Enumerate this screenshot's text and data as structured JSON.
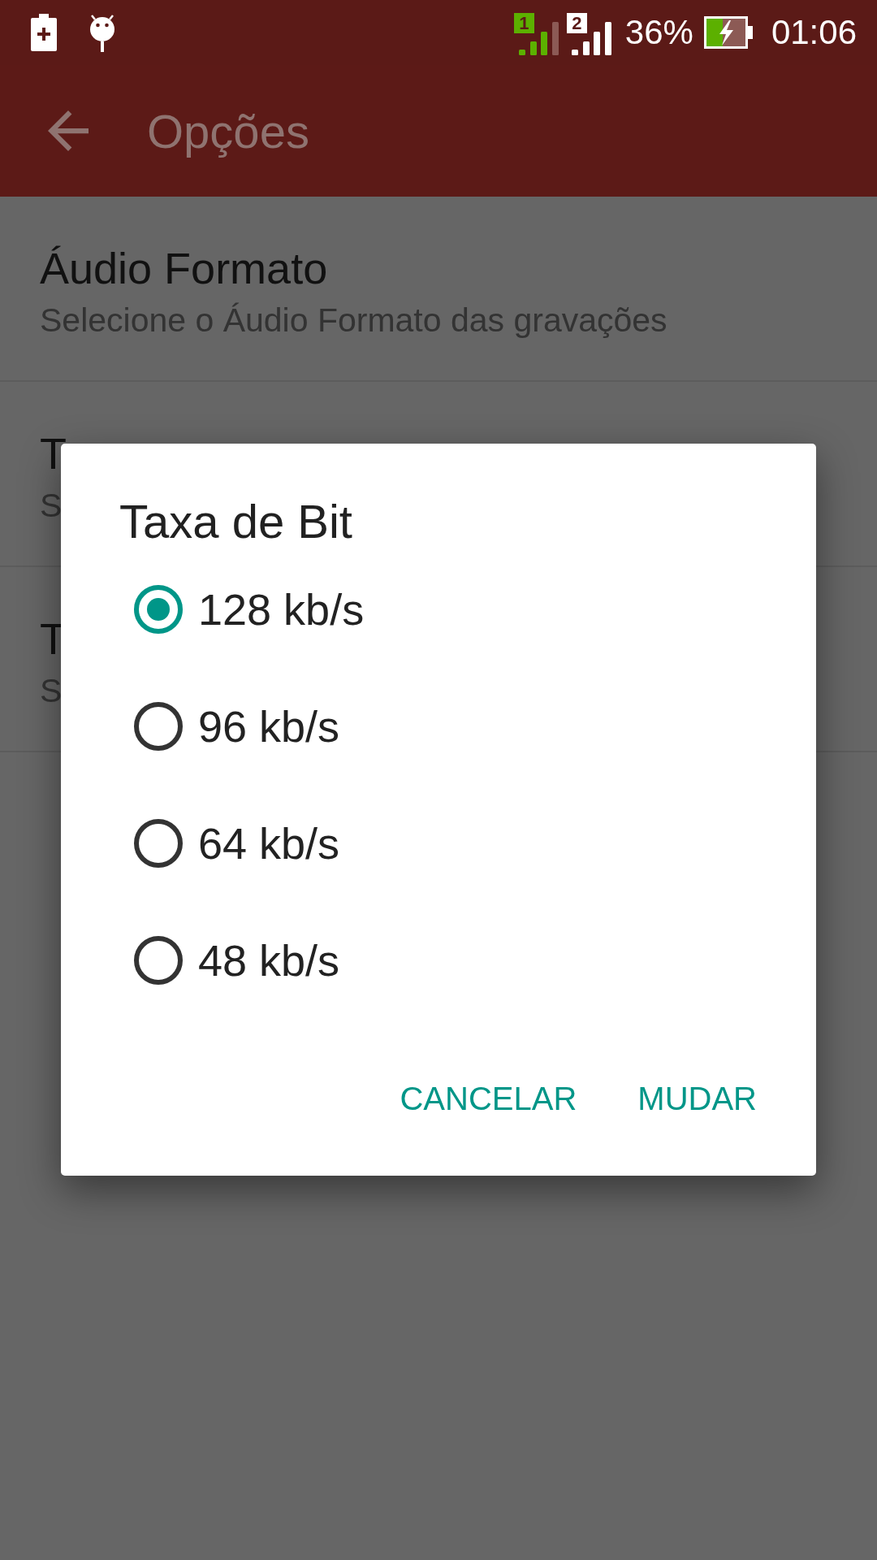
{
  "status_bar": {
    "sims": [
      {
        "label": "1",
        "color": "#5cb000",
        "kind": "partial"
      },
      {
        "label": "2",
        "color": "#ffffff",
        "kind": "full"
      }
    ],
    "battery": "36%",
    "time": "01:06"
  },
  "app_bar": {
    "title": "Opções"
  },
  "settings": [
    {
      "title": "Áudio Formato",
      "summary": "Selecione o Áudio Formato das gravações"
    },
    {
      "title": "T",
      "summary": "S"
    },
    {
      "title": "T",
      "summary": "S"
    }
  ],
  "dialog": {
    "title": "Taxa de Bit",
    "options": [
      {
        "label": "128 kb/s",
        "selected": true
      },
      {
        "label": "96 kb/s",
        "selected": false
      },
      {
        "label": "64 kb/s",
        "selected": false
      },
      {
        "label": "48 kb/s",
        "selected": false
      }
    ],
    "buttons": [
      "CANCELAR",
      "MUDAR"
    ]
  }
}
